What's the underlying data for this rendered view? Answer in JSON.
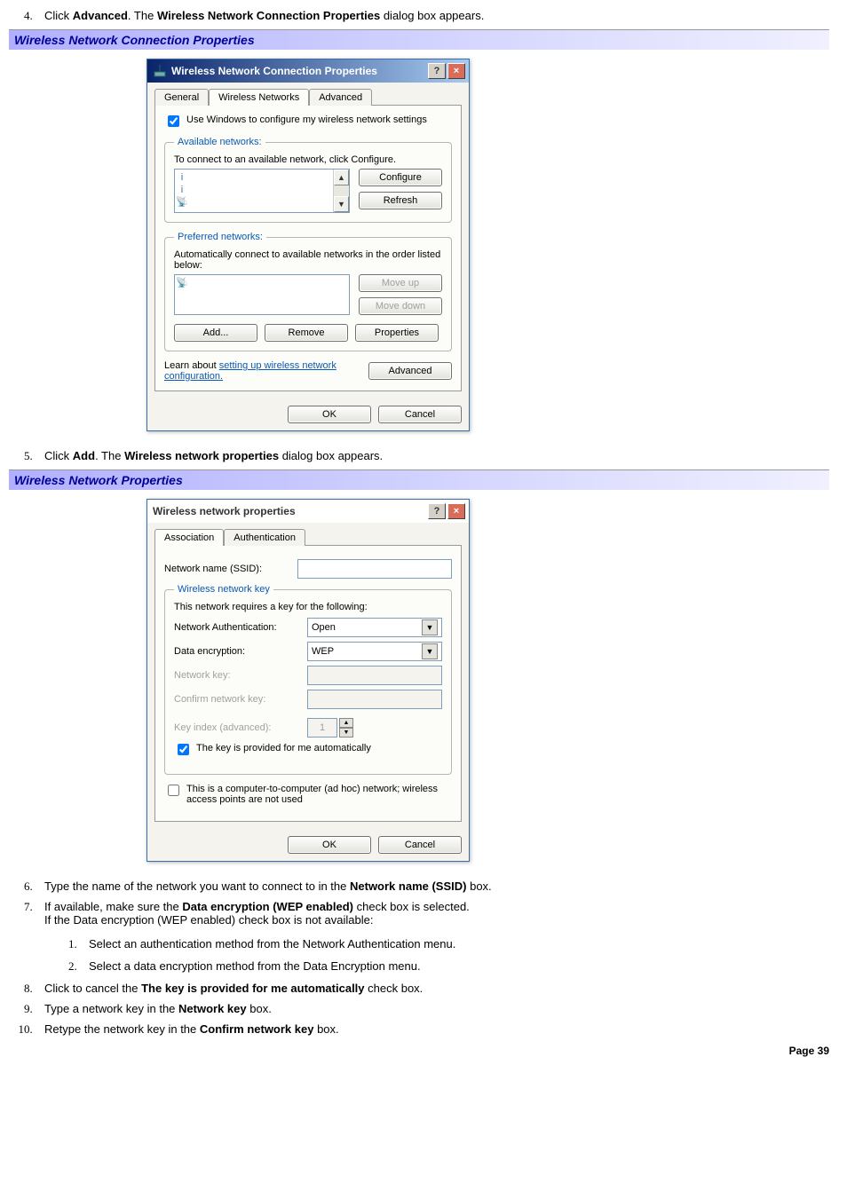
{
  "steps": {
    "s4_pre": "Click ",
    "s4_b1": "Advanced",
    "s4_mid": ". The ",
    "s4_b2": "Wireless Network Connection Properties",
    "s4_post": " dialog box appears.",
    "s5_pre": "Click ",
    "s5_b1": "Add",
    "s5_mid": ". The ",
    "s5_b2": "Wireless network properties",
    "s5_post": " dialog box appears.",
    "s6_pre": "Type the name of the network you want to connect to in the ",
    "s6_b1": "Network name (SSID)",
    "s6_post": " box.",
    "s7_pre": "If available, make sure the ",
    "s7_b1": "Data encryption (WEP enabled)",
    "s7_mid": " check box is selected.",
    "s7_line2": "If the Data encryption (WEP enabled) check box is not available:",
    "s7a": "Select an authentication method from the Network Authentication menu.",
    "s7b": "Select a data encryption method from the Data Encryption menu.",
    "s8_pre": "Click to cancel the ",
    "s8_b1": "The key is provided for me automatically",
    "s8_post": " check box.",
    "s9_pre": "Type a network key in the ",
    "s9_b1": "Network key",
    "s9_post": " box.",
    "s10_pre": "Retype the network key in the ",
    "s10_b1": "Confirm network key",
    "s10_post": " box."
  },
  "headings": {
    "h1": "Wireless Network Connection Properties",
    "h2": "Wireless Network Properties"
  },
  "dialog1": {
    "title": "Wireless Network Connection Properties",
    "tabs": {
      "general": "General",
      "wireless": "Wireless Networks",
      "advanced": "Advanced"
    },
    "use_windows": "Use Windows to configure my wireless network settings",
    "available_legend": "Available networks:",
    "available_text": "To connect to an available network, click Configure.",
    "configure": "Configure",
    "refresh": "Refresh",
    "preferred_legend": "Preferred networks:",
    "preferred_text": "Automatically connect to available networks in the order listed below:",
    "moveup": "Move up",
    "movedown": "Move down",
    "add": "Add...",
    "remove": "Remove",
    "properties": "Properties",
    "learn_pre": "Learn about ",
    "learn_link": "setting up wireless network configuration.",
    "advanced_btn": "Advanced",
    "ok": "OK",
    "cancel": "Cancel"
  },
  "dialog2": {
    "title": "Wireless network properties",
    "tabs": {
      "assoc": "Association",
      "auth": "Authentication"
    },
    "ssid_label": "Network name (SSID):",
    "wkey_legend": "Wireless network key",
    "wkey_text": "This network requires a key for the following:",
    "netauth_label": "Network Authentication:",
    "netauth_value": "Open",
    "dataenc_label": "Data encryption:",
    "dataenc_value": "WEP",
    "netkey_label": "Network key:",
    "confirm_label": "Confirm network key:",
    "keyindex_label": "Key index (advanced):",
    "keyindex_value": "1",
    "autokey": "The key is provided for me automatically",
    "adhoc": "This is a computer-to-computer (ad hoc) network; wireless access points are not used",
    "ok": "OK",
    "cancel": "Cancel"
  },
  "page_number": "Page 39"
}
